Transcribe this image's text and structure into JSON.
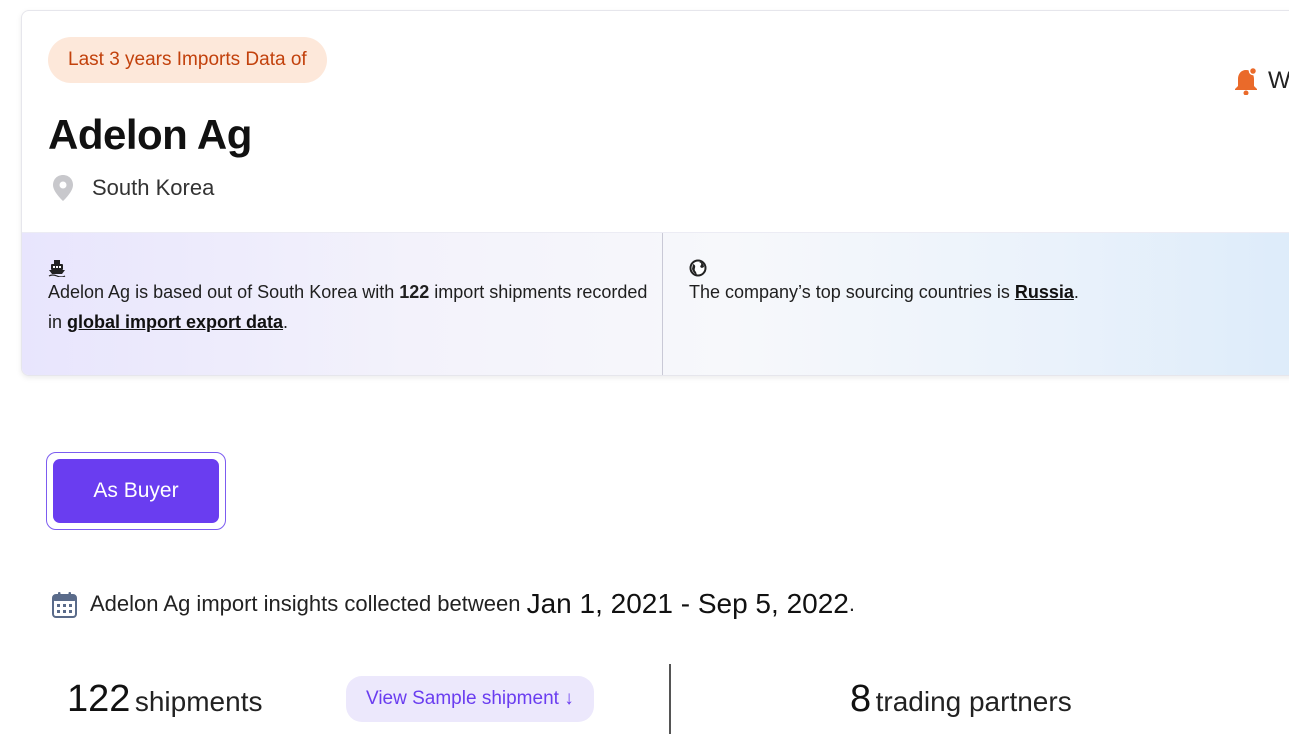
{
  "header": {
    "tag_label": "Last 3 years Imports Data of",
    "company_name": "Adelon Ag",
    "country": "South Korea",
    "watch_label": "W"
  },
  "info": {
    "left_p1": "Adelon Ag is based out of South Korea with ",
    "left_shipments": "122",
    "left_p2": " import shipments recorded in ",
    "left_link": "global import export data",
    "left_p3": ".",
    "right_p1": "The company’s top sourcing countries is ",
    "right_link": "Russia",
    "right_p2": "."
  },
  "role_tab": {
    "label": "As Buyer"
  },
  "insights": {
    "company": "Adelon Ag",
    "text": " import insights collected between ",
    "range": "Jan 1, 2021 - Sep 5, 2022",
    "end": "."
  },
  "stats": {
    "shipments_count": "122",
    "shipments_label": "shipments",
    "sample_button": "View Sample shipment ↓",
    "partners_count": "8",
    "partners_label": "trading partners"
  },
  "colors": {
    "accent": "#6a3df0",
    "tag_bg": "#fde8da",
    "tag_text": "#c2410c",
    "watch_icon": "#ea6a2a"
  },
  "icons": {
    "location": "map-pin-icon",
    "watch": "bell-icon",
    "ship": "ship-icon",
    "globe": "globe-icon",
    "calendar": "calendar-icon"
  }
}
